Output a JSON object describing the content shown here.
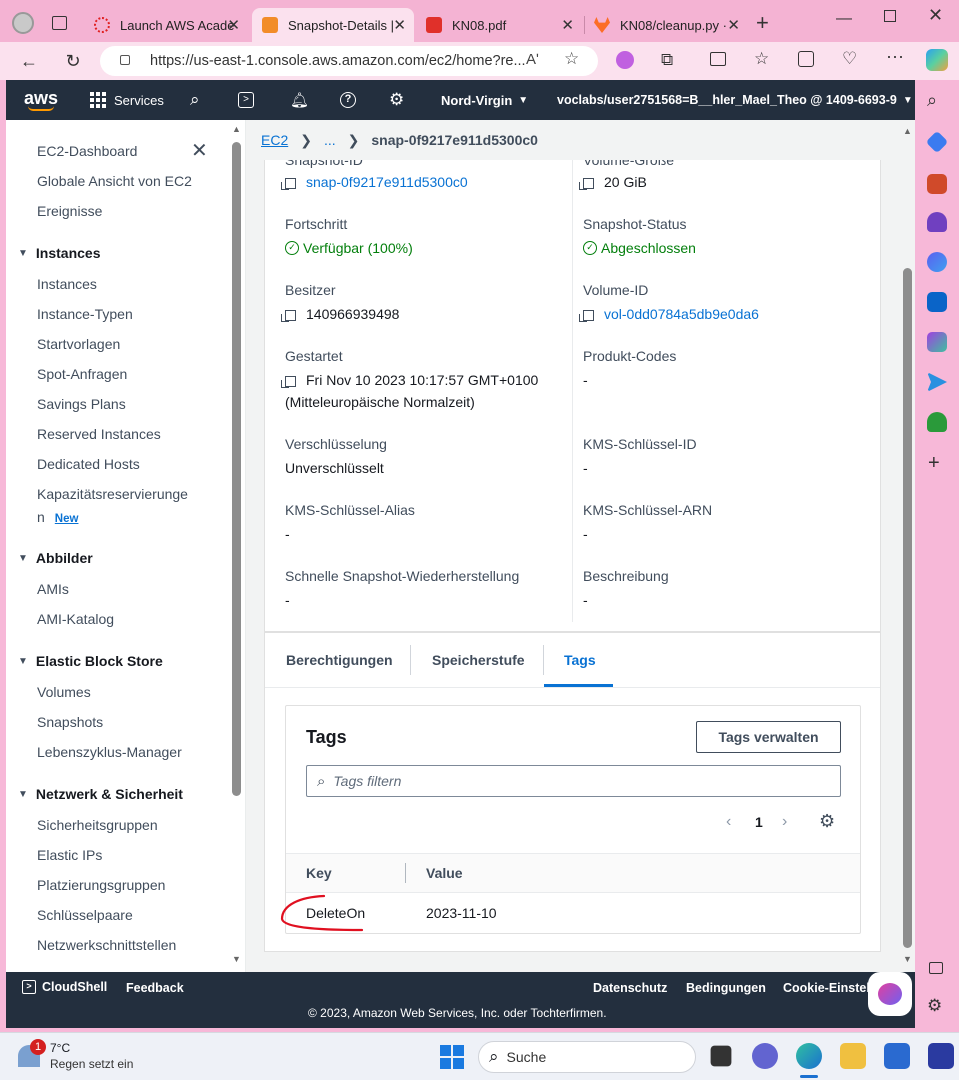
{
  "browser": {
    "tabs": [
      {
        "title": "Launch AWS Acade",
        "active": false
      },
      {
        "title": "Snapshot-Details |",
        "active": true
      },
      {
        "title": "KN08.pdf",
        "active": false
      },
      {
        "title": "KN08/cleanup.py ·",
        "active": false
      }
    ],
    "url": "https://us-east-1.console.aws.amazon.com/ec2/home?re...",
    "read_aloud": "Aʹ"
  },
  "aws_nav": {
    "logo": "aws",
    "services": "Services",
    "region": "Nord-Virgin",
    "account": "voclabs/user2751568=B__hler_Mael_Theo @ 1409-6693-9"
  },
  "sidebar": {
    "top_items": [
      "EC2-Dashboard",
      "Globale Ansicht von EC2",
      "Ereignisse"
    ],
    "sections": [
      {
        "title": "Instances",
        "items": [
          "Instances",
          "Instance-Typen",
          "Startvorlagen",
          "Spot-Anfragen",
          "Savings Plans",
          "Reserved Instances",
          "Dedicated Hosts",
          "Kapazitätsreservierunge",
          "n"
        ]
      },
      {
        "title": "Abbilder",
        "items": [
          "AMIs",
          "AMI-Katalog"
        ]
      },
      {
        "title": "Elastic Block Store",
        "items": [
          "Volumes",
          "Snapshots",
          "Lebenszyklus-Manager"
        ]
      },
      {
        "title": "Netzwerk & Sicherheit",
        "items": [
          "Sicherheitsgruppen",
          "Elastic IPs",
          "Platzierungsgruppen",
          "Schlüsselpaare",
          "Netzwerkschnittstellen"
        ]
      }
    ],
    "new_badge": "New"
  },
  "breadcrumb": {
    "root": "EC2",
    "ellipsis": "...",
    "current": "snap-0f9217e911d5300c0"
  },
  "details": {
    "snapshot_id_label": "Snapshot-ID",
    "snapshot_id": "snap-0f9217e911d5300c0",
    "volume_size_label": "Volume-Größe",
    "volume_size": "20 GiB",
    "progress_label": "Fortschritt",
    "progress": "Verfügbar (100%)",
    "status_label": "Snapshot-Status",
    "status": "Abgeschlossen",
    "owner_label": "Besitzer",
    "owner": "140966939498",
    "volume_id_label": "Volume-ID",
    "volume_id": "vol-0dd0784a5db9e0da6",
    "started_label": "Gestartet",
    "started": "Fri Nov 10 2023 10:17:57 GMT+0100",
    "started_tz": "(Mitteleuropäische Normalzeit)",
    "product_codes_label": "Produkt-Codes",
    "product_codes": "-",
    "encryption_label": "Verschlüsselung",
    "encryption": "Unverschlüsselt",
    "kms_id_label": "KMS-Schlüssel-ID",
    "kms_id": "-",
    "kms_alias_label": "KMS-Schlüssel-Alias",
    "kms_alias": "-",
    "kms_arn_label": "KMS-Schlüssel-ARN",
    "kms_arn": "-",
    "fast_restore_label": "Schnelle Snapshot-Wiederherstellung",
    "fast_restore": "-",
    "description_label": "Beschreibung",
    "description": "-"
  },
  "subtabs": [
    "Berechtigungen",
    "Speicherstufe",
    "Tags"
  ],
  "tags_panel": {
    "title": "Tags",
    "manage_button": "Tags verwalten",
    "filter_placeholder": "Tags filtern",
    "page": "1",
    "columns": [
      "Key",
      "Value"
    ],
    "rows": [
      {
        "key": "DeleteOn",
        "value": "2023-11-10"
      }
    ]
  },
  "footer": {
    "cloudshell": "CloudShell",
    "feedback": "Feedback",
    "privacy": "Datenschutz",
    "terms": "Bedingungen",
    "cookies": "Cookie-Einstell",
    "copyright": "© 2023, Amazon Web Services, Inc. oder Tochterfirmen."
  },
  "taskbar": {
    "weather_badge": "1",
    "temp": "7°C",
    "weather": "Regen setzt ein",
    "search": "Suche"
  },
  "colors": {
    "aws_dark": "#232f3e",
    "link": "#0972d3",
    "success": "#037f0c",
    "tab_pink": "#f4b3d3"
  }
}
